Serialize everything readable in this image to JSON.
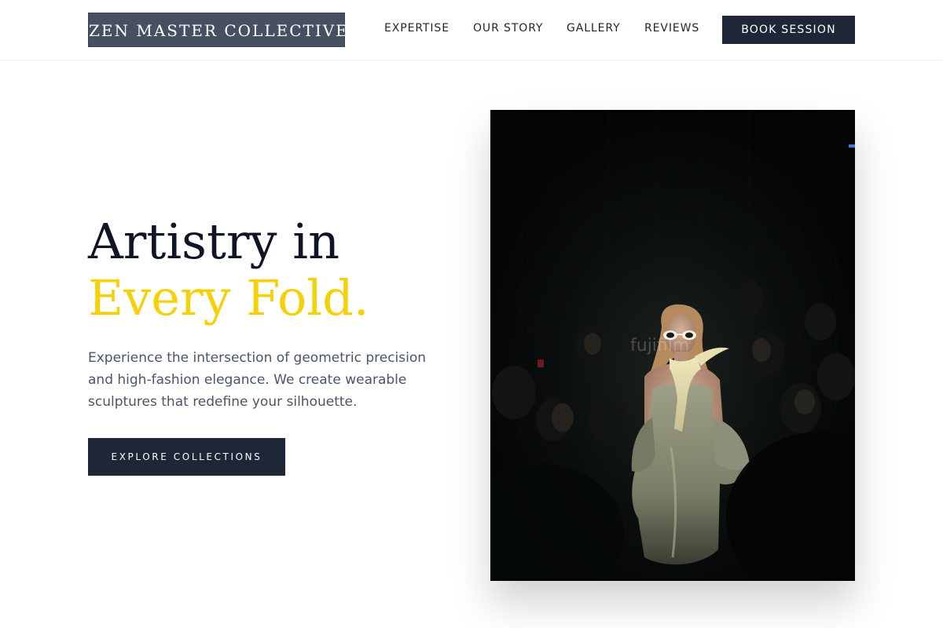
{
  "header": {
    "logo": "ZEN MASTER COLLECTIVE",
    "nav": [
      "EXPERTISE",
      "OUR STORY",
      "GALLERY",
      "REVIEWS"
    ],
    "cta": "BOOK SESSION"
  },
  "hero": {
    "title_line1": "Artistry in",
    "title_line2": "Every Fold.",
    "description": "Experience the intersection of geometric precision and high-fashion elegance. We create wearable sculptures that redefine your silhouette.",
    "cta": "EXPLORE COLLECTIONS",
    "image": {
      "subject": "runway model in sage satin dress with white sunglasses and pale scarf",
      "watermark": "fujifilm"
    }
  },
  "colors": {
    "accent": "#f5d10c",
    "navy": "#1e2638",
    "logo_bg": "#475063",
    "text_dark": "#0f1527",
    "text_muted": "#4b5567"
  }
}
